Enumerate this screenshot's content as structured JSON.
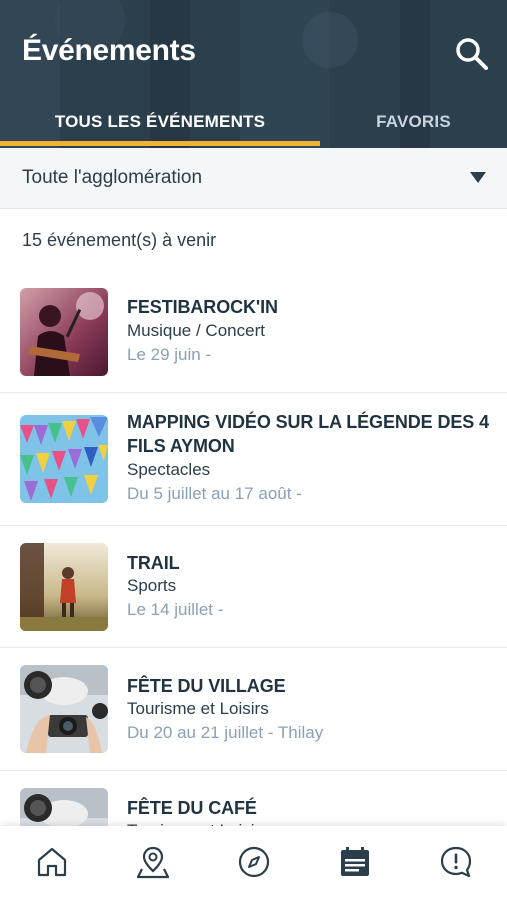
{
  "header": {
    "title": "Événements",
    "search_icon": "search-icon",
    "bg_color": "#2b3e4c"
  },
  "tabs": [
    {
      "label": "TOUS LES ÉVÉNEMENTS",
      "active": true
    },
    {
      "label": "FAVORIS",
      "active": false
    }
  ],
  "accent_color": "#f2b233",
  "filter": {
    "label": "Toute l'agglomération",
    "icon": "caret-down-icon"
  },
  "count_text": "15 événement(s) à venir",
  "events": [
    {
      "title": "FESTIBAROCK'IN",
      "category": "Musique / Concert",
      "date": "Le 29 juin -",
      "thumb": "guitarist-photo"
    },
    {
      "title": "MAPPING VIDÉO SUR LA LÉGENDE DES 4 FILS AYMON",
      "category": "Spectacles",
      "date": "Du 5 juillet au 17 août -",
      "thumb": "bunting-flags-photo"
    },
    {
      "title": "TRAIL",
      "category": "Sports",
      "date": "Le 14 juillet -",
      "thumb": "runners-photo"
    },
    {
      "title": "FÊTE DU VILLAGE",
      "category": "Tourisme et Loisirs",
      "date": "Du 20 au 21 juillet - Thilay",
      "thumb": "photographer-photo"
    },
    {
      "title": "FÊTE DU CAFÉ",
      "category": "Tourisme et Loisirs",
      "date": "",
      "thumb": "photographer-photo"
    }
  ],
  "tabbar": [
    {
      "icon": "home-icon",
      "active": false
    },
    {
      "icon": "map-pin-icon",
      "active": false
    },
    {
      "icon": "compass-icon",
      "active": false
    },
    {
      "icon": "calendar-icon",
      "active": true
    },
    {
      "icon": "alert-bubble-icon",
      "active": false
    }
  ]
}
